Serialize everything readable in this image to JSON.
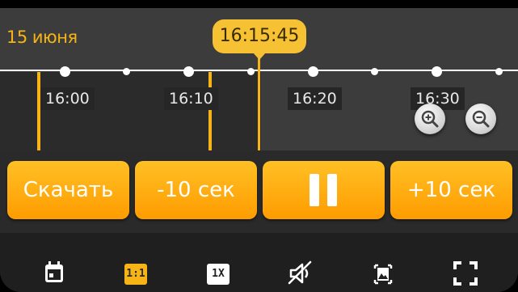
{
  "timeline": {
    "date": "15 июня",
    "current_time": "16:15:45",
    "ticks": [
      "16:00",
      "16:10",
      "16:20",
      "16:30"
    ]
  },
  "zoom": {
    "zoom_in_icon": "zoom-in-icon",
    "zoom_out_icon": "zoom-out-icon"
  },
  "controls": {
    "download_label": "Скачать",
    "back_label": "-10 сек",
    "pause_icon": "pause-icon",
    "forward_label": "+10 сек"
  },
  "toolbar": {
    "calendar_icon": "calendar-icon",
    "aspect_label": "1:1",
    "speed_label": "1X",
    "mute_icon": "speaker-muted-icon",
    "snapshot_icon": "image-icon",
    "fullscreen_icon": "fullscreen-icon"
  },
  "colors": {
    "accent": "#f6b417",
    "button": "#ffb314",
    "background": "#2a2a2a"
  }
}
